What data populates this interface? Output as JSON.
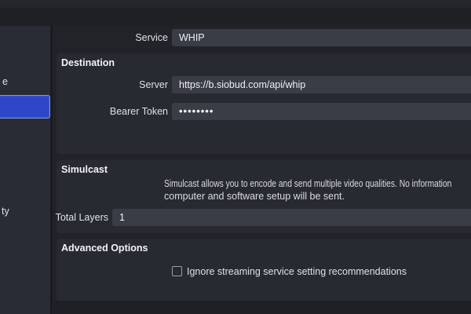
{
  "colors": {
    "topbar_top": "#26272b",
    "topbar_bg": "#1e2024",
    "sidebar_bg": "#292c35",
    "seam": "#191b20",
    "main_bg": "#212329",
    "group_bg": "#272a31",
    "field_bg": "#3a3d46",
    "field_text": "#eef0f2",
    "label_text": "#dfe1e4",
    "title_text": "#f2f3f5",
    "desc_text": "#d9dbde",
    "accent": "#2e46c8",
    "accent_border": "#7e92ea",
    "bottom_band": "#1e2025",
    "checkbox_border": "#989da6"
  },
  "sidebar": {
    "fragments": [
      {
        "text": "e"
      },
      {
        "text": "ty"
      }
    ],
    "selected_item": {
      "label": ""
    }
  },
  "form": {
    "service": {
      "label": "Service",
      "value": "WHIP"
    },
    "destination": {
      "title": "Destination",
      "server": {
        "label": "Server",
        "value": "https://b.siobud.com/api/whip"
      },
      "bearer_token": {
        "label": "Bearer Token",
        "value_masked": "••••••••"
      }
    },
    "simulcast": {
      "title": "Simulcast",
      "description_line1": "Simulcast allows you to encode and send multiple video qualities. No information",
      "description_line2": "computer and software setup will be sent.",
      "total_layers": {
        "label": "Total Layers",
        "value": "1"
      }
    },
    "advanced": {
      "title": "Advanced Options",
      "checkbox": {
        "label": "Ignore streaming service setting recommendations",
        "checked": false
      }
    }
  }
}
